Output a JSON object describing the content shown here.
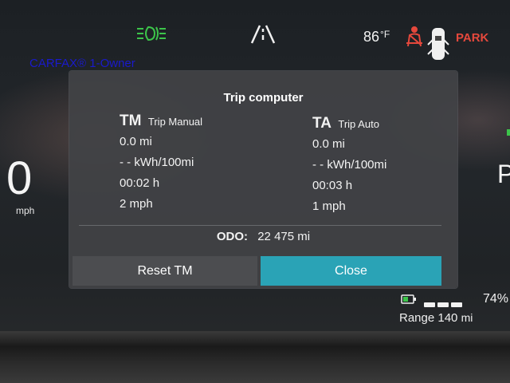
{
  "watermark": "CARFAX® 1-Owner",
  "status_bar": {
    "temperature": "86",
    "temperature_unit": "°F",
    "gear": "PARK",
    "icons": [
      "headlights-icon",
      "lane-keeping-icon",
      "seatbelt-warning-icon",
      "car-doors-icon"
    ]
  },
  "speedometer": {
    "value": "0",
    "unit": "mph"
  },
  "right_gauge_partial": "P",
  "trip_computer": {
    "title": "Trip computer",
    "trip_manual": {
      "code": "TM",
      "name": "Trip Manual",
      "distance": "0.0 mi",
      "consumption": "- - kWh/100mi",
      "time": "00:02 h",
      "avg_speed": "2 mph"
    },
    "trip_auto": {
      "code": "TA",
      "name": "Trip Auto",
      "distance": "0.0 mi",
      "consumption": "- - kWh/100mi",
      "time": "00:03 h",
      "avg_speed": "1 mph"
    },
    "odometer": {
      "label": "ODO:",
      "value": "22 475",
      "unit": "mi"
    },
    "buttons": {
      "reset": "Reset TM",
      "close": "Close"
    }
  },
  "battery": {
    "percent": "74%",
    "level_fraction": 0.74,
    "range_label": "Range",
    "range_value": "140",
    "range_unit": "mi"
  },
  "colors": {
    "accent_button": "#2aa3b6",
    "warning_red": "#e5483c",
    "indicator_green": "#3cc44a",
    "watermark_blue": "#1a1acc"
  }
}
